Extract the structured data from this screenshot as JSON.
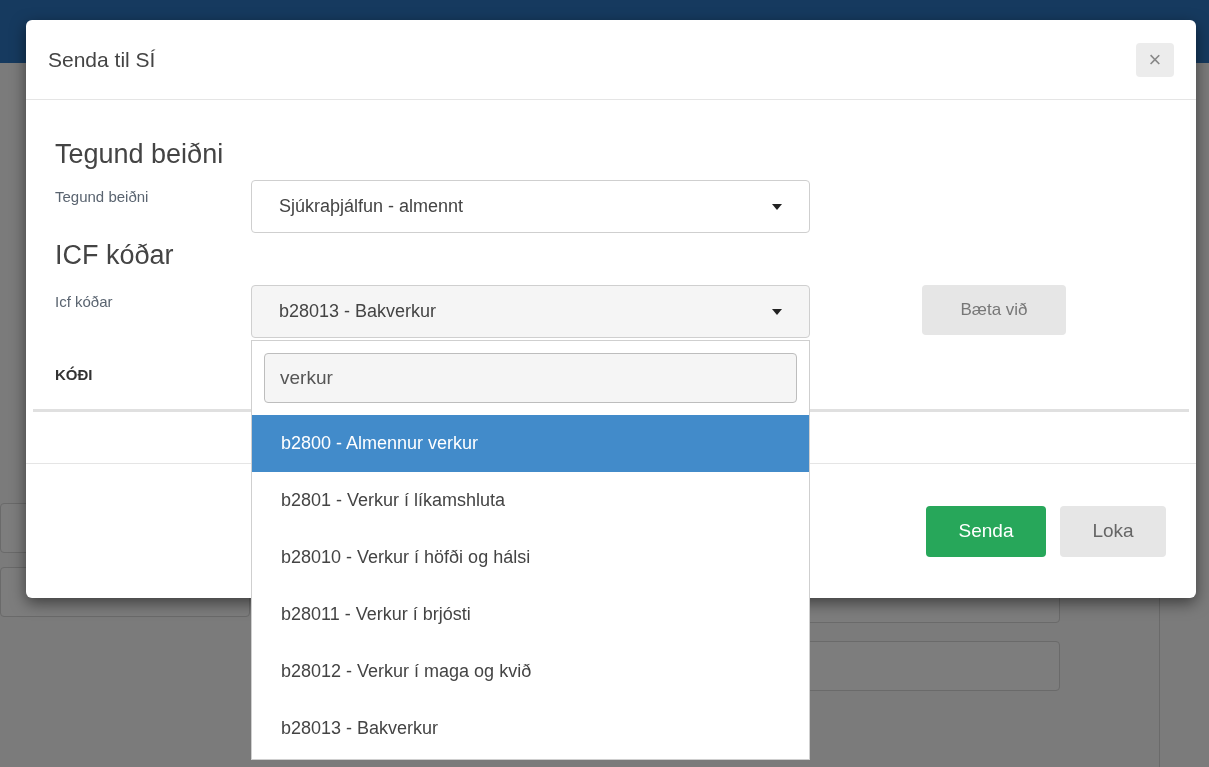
{
  "dialog": {
    "title": "Senda til SÍ",
    "close": "×",
    "section_1": {
      "heading": "Tegund beiðni",
      "label": "Tegund beiðni",
      "value": "Sjúkraþjálfun - almennt"
    },
    "section_2": {
      "heading": "ICF kóðar",
      "label": "Icf kóðar",
      "value": "b28013 - Bakverkur",
      "add_button": "Bæta við"
    },
    "table": {
      "columns": [
        "KÓÐI"
      ]
    },
    "dropdown": {
      "search": "verkur",
      "options": [
        {
          "label": "b2800 - Almennur verkur",
          "selected": true
        },
        {
          "label": "b2801 - Verkur í líkamshluta",
          "selected": false
        },
        {
          "label": "b28010 - Verkur í höfði og hálsi",
          "selected": false
        },
        {
          "label": "b28011 - Verkur í brjósti",
          "selected": false
        },
        {
          "label": "b28012 - Verkur í maga og kvið",
          "selected": false
        },
        {
          "label": "b28013 - Bakverkur",
          "selected": false
        }
      ]
    },
    "buttons": [
      {
        "label": "Senda",
        "kind": "primary"
      },
      {
        "label": "Loka",
        "kind": "secondary"
      }
    ]
  }
}
